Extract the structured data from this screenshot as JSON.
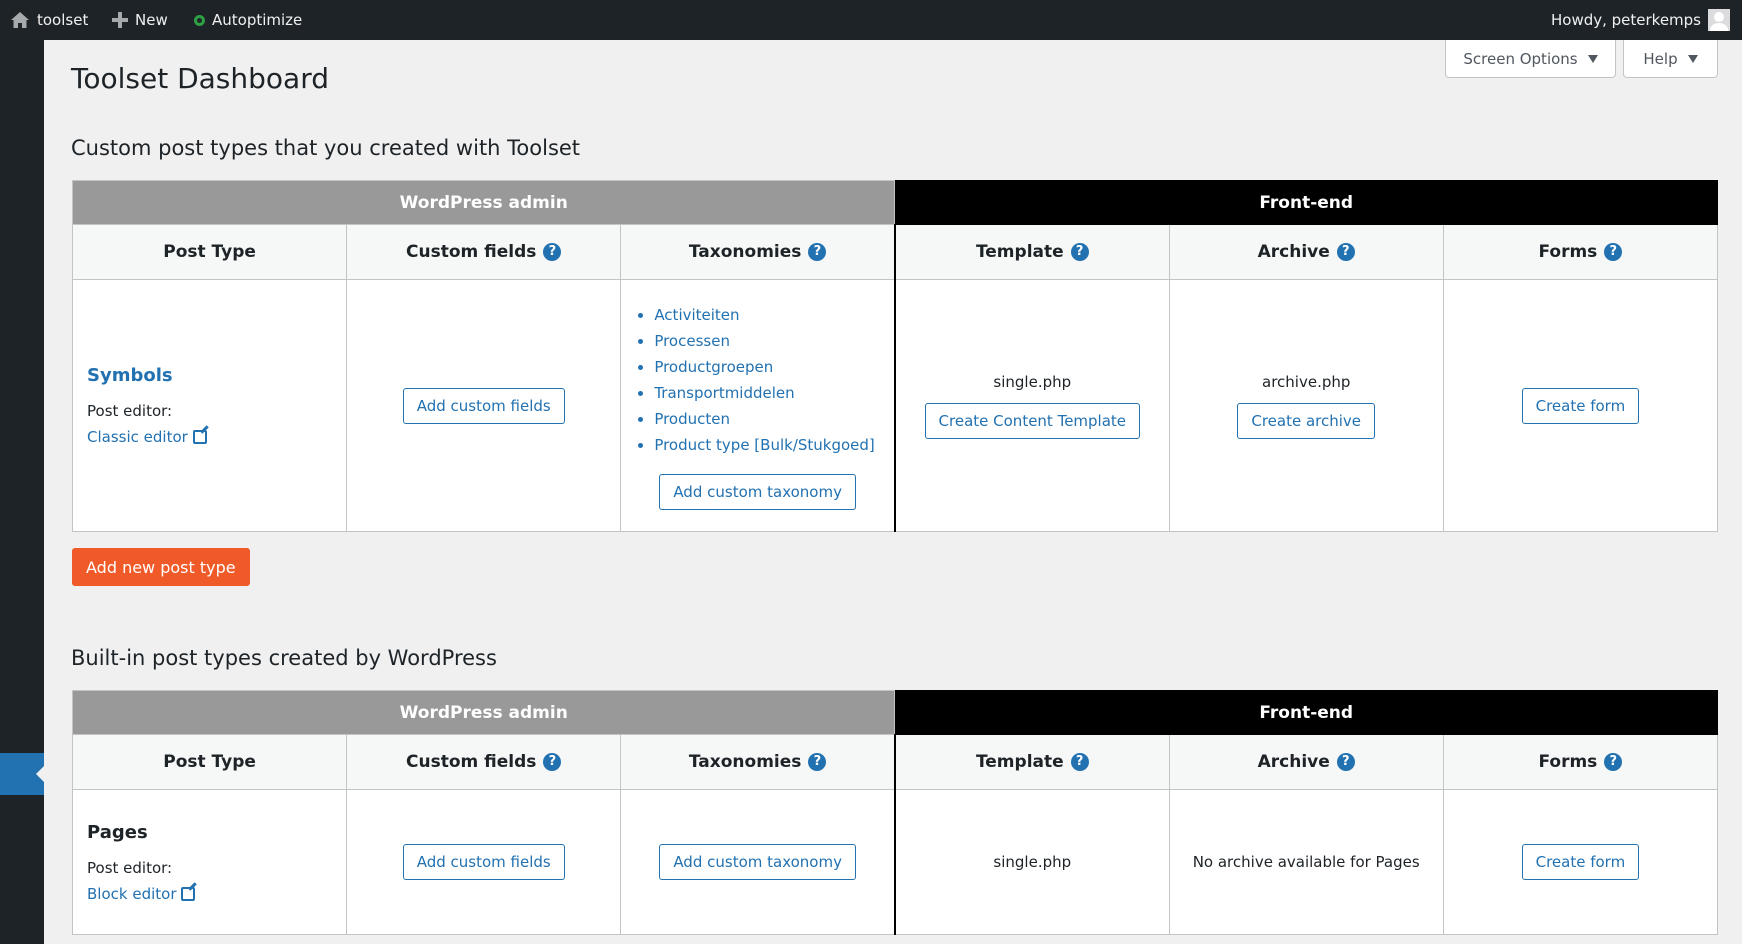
{
  "adminbar": {
    "site_name": "toolset",
    "new_label": "New",
    "autoptimize_label": "Autoptimize",
    "howdy": "Howdy, peterkemps"
  },
  "tabs": {
    "screen_options": "Screen Options",
    "help": "Help"
  },
  "page_title": "Toolset Dashboard",
  "custom_section": {
    "title": "Custom post types that you created with Toolset",
    "group_wp": "WordPress admin",
    "group_fe": "Front-end",
    "headers": [
      "Post Type",
      "Custom fields",
      "Taxonomies",
      "Template",
      "Archive",
      "Forms"
    ],
    "row": {
      "post_type": "Symbols",
      "post_editor_label": "Post editor:",
      "editor": "Classic editor",
      "custom_fields_btn": "Add custom fields",
      "taxonomies": [
        "Activiteiten",
        "Processen",
        "Productgroepen",
        "Transportmiddelen",
        "Producten",
        "Product type [Bulk/Stukgoed]"
      ],
      "taxonomy_btn": "Add custom taxonomy",
      "template_file": "single.php",
      "template_btn": "Create Content Template",
      "archive_file": "archive.php",
      "archive_btn": "Create archive",
      "forms_btn": "Create form"
    },
    "add_new_btn": "Add new post type"
  },
  "builtin_section": {
    "title": "Built-in post types created by WordPress",
    "group_wp": "WordPress admin",
    "group_fe": "Front-end",
    "headers": [
      "Post Type",
      "Custom fields",
      "Taxonomies",
      "Template",
      "Archive",
      "Forms"
    ],
    "row": {
      "post_type": "Pages",
      "post_editor_label": "Post editor:",
      "editor": "Block editor",
      "custom_fields_btn": "Add custom fields",
      "taxonomy_btn": "Add custom taxonomy",
      "template_file": "single.php",
      "archive_text": "No archive available for Pages",
      "forms_btn": "Create form"
    }
  },
  "colors": {
    "accent": "#2271b1",
    "primary_button": "#f05a28",
    "adminbar": "#1d2327"
  }
}
